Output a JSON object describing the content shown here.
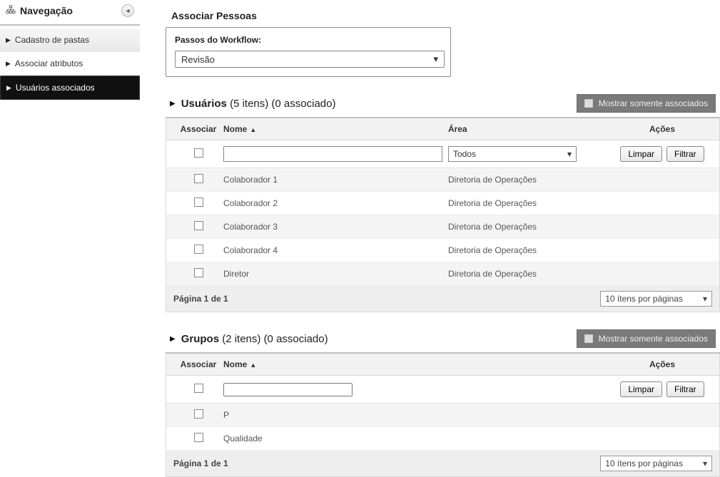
{
  "sidebar": {
    "title": "Navegação",
    "items": [
      {
        "label": "Cadastro de pastas"
      },
      {
        "label": "Associar atributos"
      },
      {
        "label": "Usuários associados"
      }
    ]
  },
  "page": {
    "title": "Associar Pessoas"
  },
  "workflow": {
    "label": "Passos do Workflow:",
    "selected": "Revisão"
  },
  "users": {
    "title_strong": "Usuários",
    "title_rest": " (5 itens) (0 associado)",
    "show_assoc_label": "Mostrar somente associados",
    "head": {
      "assoc": "Associar",
      "nome": "Nome",
      "area": "Área",
      "acoes": "Ações"
    },
    "filter": {
      "area_selected": "Todos",
      "limpar": "Limpar",
      "filtrar": "Filtrar"
    },
    "rows": [
      {
        "nome": "Colaborador 1",
        "area": "Diretoria de Operações"
      },
      {
        "nome": "Colaborador 2",
        "area": "Diretoria de Operações"
      },
      {
        "nome": "Colaborador 3",
        "area": "Diretoria de Operações"
      },
      {
        "nome": "Colaborador 4",
        "area": "Diretoria de Operações"
      },
      {
        "nome": "Diretor",
        "area": "Diretoria de Operações"
      }
    ],
    "foot": {
      "page": "Página 1 de 1",
      "pagesize": "10 ítens por páginas"
    }
  },
  "groups": {
    "title_strong": "Grupos",
    "title_rest": " (2 itens) (0 associado)",
    "show_assoc_label": "Mostrar somente associados",
    "head": {
      "assoc": "Associar",
      "nome": "Nome",
      "acoes": "Ações"
    },
    "filter": {
      "limpar": "Limpar",
      "filtrar": "Filtrar"
    },
    "rows": [
      {
        "nome": "P"
      },
      {
        "nome": "Qualidade"
      }
    ],
    "foot": {
      "page": "Página 1 de 1",
      "pagesize": "10 ítens por páginas"
    }
  }
}
